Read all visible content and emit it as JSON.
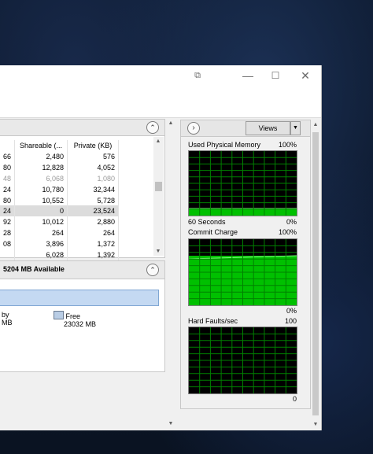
{
  "window_controls": {
    "restore": "⧉",
    "minimize": "—",
    "maximize": "☐",
    "close": "✕"
  },
  "process_table": {
    "collapse_glyph": "⌃",
    "columns": [
      "Shareable (...",
      "Private (KB)"
    ],
    "rows": [
      {
        "pid": "66",
        "shareable": "2,480",
        "private": "576"
      },
      {
        "pid": "80",
        "shareable": "12,828",
        "private": "4,052"
      },
      {
        "pid": "48",
        "shareable": "6,068",
        "private": "1,080",
        "dim": true
      },
      {
        "pid": "24",
        "shareable": "10,780",
        "private": "32,344"
      },
      {
        "pid": "80",
        "shareable": "10,552",
        "private": "5,728"
      },
      {
        "pid": "24",
        "shareable": "0",
        "private": "23,524",
        "selected": true
      },
      {
        "pid": "92",
        "shareable": "10,012",
        "private": "2,880"
      },
      {
        "pid": "28",
        "shareable": "264",
        "private": "264"
      },
      {
        "pid": "08",
        "shareable": "3,896",
        "private": "1,372"
      },
      {
        "pid": "",
        "shareable": "6,028",
        "private": "1,392"
      }
    ]
  },
  "physical_memory": {
    "header": "5204 MB Available",
    "collapse_glyph": "⌃",
    "legend": [
      {
        "label": "by",
        "value": "MB"
      },
      {
        "label": "Free",
        "value": "23032 MB",
        "color": "#b9cde5"
      }
    ]
  },
  "graphs_panel": {
    "nav_glyph": "›",
    "views_label": "Views",
    "views_arrow": "▼",
    "graphs": [
      {
        "title": "Used Physical Memory",
        "max": "100%",
        "time": "60 Seconds",
        "min": "0%",
        "fill_level": 0.11
      },
      {
        "title": "Commit Charge",
        "max": "100%",
        "min": "0%",
        "fill_level": 0.75
      },
      {
        "title": "Hard Faults/sec",
        "max": "100",
        "min": "0",
        "fill_level": 0.0
      }
    ]
  },
  "colors": {
    "graph_bg": "#000000",
    "graph_grid": "#008000",
    "graph_fill": "#00c000",
    "graph_line": "#7cff7c"
  }
}
